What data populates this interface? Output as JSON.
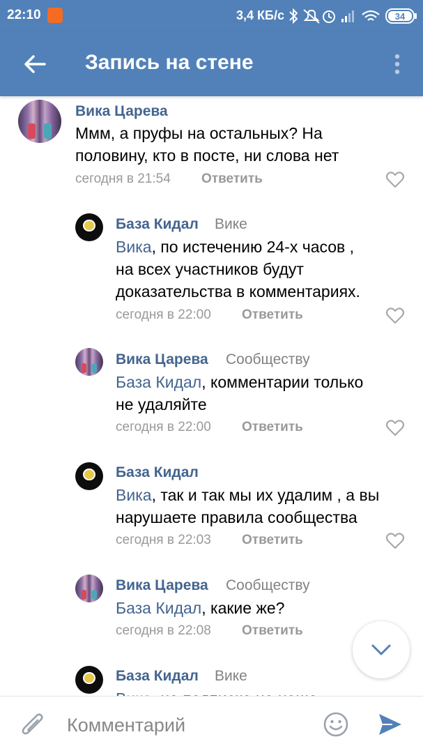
{
  "status_bar": {
    "time": "22:10",
    "speed": "3,4 КБ/с",
    "battery": "34",
    "icons": [
      "notification-icon",
      "bluetooth-icon",
      "mute-icon",
      "alarm-icon",
      "signal-icon",
      "wifi-icon",
      "battery-icon"
    ]
  },
  "header": {
    "title": "Запись на стене",
    "back_icon": "arrow-left-icon",
    "more_icon": "more-vertical-icon"
  },
  "comments": [
    {
      "author": "Вика Царева",
      "reply_to": "",
      "mention": "",
      "text_lines": [
        "Ммм, а пруфы на остальных? На",
        "половину, кто в посте, ни слова нет"
      ],
      "time": "сегодня в 21:54",
      "reply_label": "Ответить"
    },
    {
      "author": "База Кидал",
      "reply_to": "Вике",
      "mention": "Вика",
      "text_lines": [
        ", по истечению 24-х часов ,",
        "на всех участников будут",
        "доказательства в комментариях."
      ],
      "time": "сегодня в 22:00",
      "reply_label": "Ответить"
    },
    {
      "author": "Вика Царева",
      "reply_to": "Сообществу",
      "mention": "База Кидал",
      "text_lines": [
        ", комментарии только",
        "не удаляйте"
      ],
      "time": "сегодня в 22:00",
      "reply_label": "Ответить"
    },
    {
      "author": "База Кидал",
      "reply_to": "",
      "mention": "Вика",
      "text_lines": [
        ", так и так мы их удалим , а вы",
        "нарушаете правила сообщества"
      ],
      "time": "сегодня в 22:03",
      "reply_label": "Ответить"
    },
    {
      "author": "Вика Царева",
      "reply_to": "Сообществу",
      "mention": "База Кидал",
      "text_lines": [
        ", какие же?"
      ],
      "time": "сегодня в 22:08",
      "reply_label": "Ответить"
    },
    {
      "author": "База Кидал",
      "reply_to": "Вике",
      "mention": "Вика",
      "text_lines": [
        ", не подписка на наше"
      ],
      "time": "",
      "reply_label": ""
    }
  ],
  "composer": {
    "placeholder": "Комментарий",
    "attach_icon": "paperclip-icon",
    "emoji_icon": "smile-icon",
    "send_icon": "send-icon"
  },
  "scroll_button_icon": "chevron-down-icon",
  "colors": {
    "header": "#5181b8",
    "link": "#43648f",
    "meta": "#999999",
    "accent": "#5181b8"
  }
}
